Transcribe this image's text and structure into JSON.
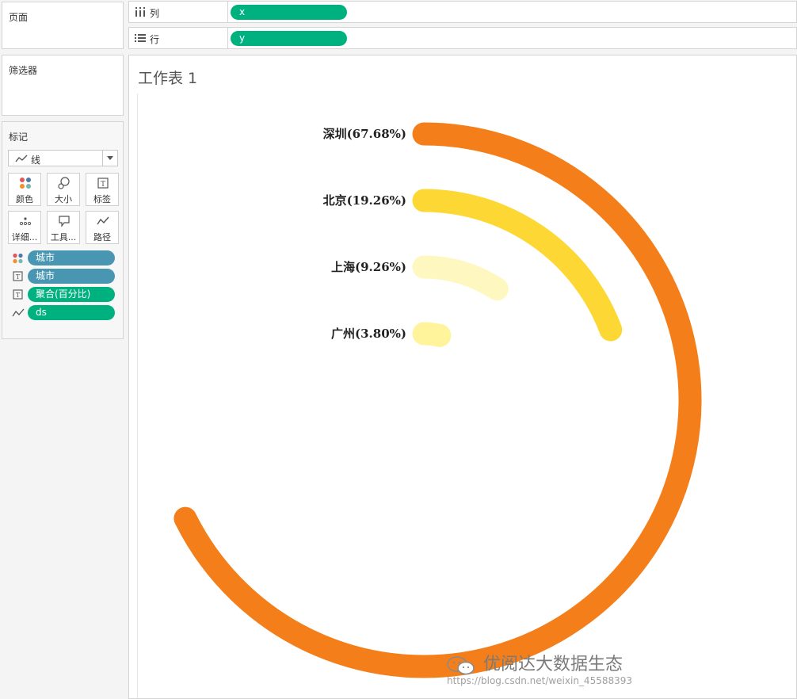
{
  "left_panel": {
    "pages_title": "页面",
    "filters_title": "筛选器",
    "marks_title": "标记",
    "mark_type": "线",
    "cards": [
      {
        "label": "颜色",
        "icon": "color-dots-icon"
      },
      {
        "label": "大小",
        "icon": "size-icon"
      },
      {
        "label": "标签",
        "icon": "label-icon"
      },
      {
        "label": "详细...",
        "icon": "detail-icon"
      },
      {
        "label": "工具...",
        "icon": "tooltip-icon"
      },
      {
        "label": "路径",
        "icon": "path-icon"
      }
    ],
    "mark_pills": [
      {
        "label": "城市",
        "icon": "color-dots-icon",
        "color": "#4996b2"
      },
      {
        "label": "城市",
        "icon": "label-icon",
        "color": "#4996b2"
      },
      {
        "label": "聚合(百分比)",
        "icon": "label-icon",
        "color": "#00b180"
      },
      {
        "label": "ds",
        "icon": "path-icon",
        "color": "#00b180"
      }
    ]
  },
  "shelves": {
    "columns": {
      "label": "列",
      "pill": "x"
    },
    "rows": {
      "label": "行",
      "pill": "y"
    }
  },
  "worksheet": {
    "title": "工作表 1"
  },
  "watermark": {
    "text": "优阅达大数据生态",
    "url": "https://blog.csdn.net/weixin_45588393"
  },
  "chart_data": {
    "type": "radial-bar",
    "start_angle_deg": 0,
    "direction": "clockwise",
    "categories": [
      "深圳",
      "北京",
      "上海",
      "广州"
    ],
    "values": [
      67.68,
      19.26,
      9.26,
      3.8
    ],
    "labels": [
      "深圳(67.68%)",
      "北京(19.26%)",
      "上海(9.26%)",
      "广州(3.80%)"
    ],
    "colors": [
      "#f47f1a",
      "#fdd835",
      "#fff7c0",
      "#fff49b"
    ]
  }
}
